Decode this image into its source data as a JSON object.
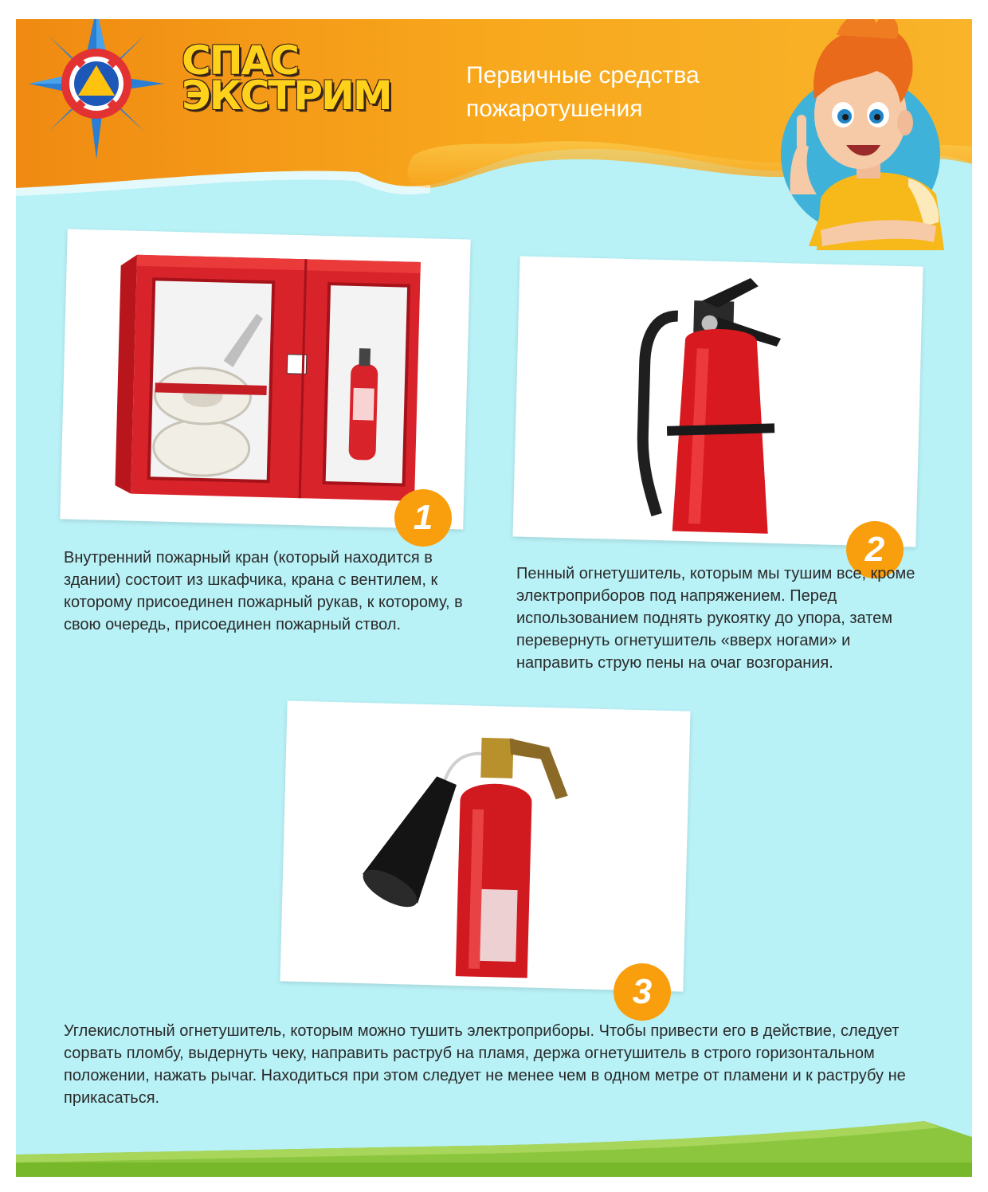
{
  "header": {
    "brand_line1": "СПАС",
    "brand_line2": "ЭКСТРИМ",
    "title": "Первичные средства пожаротушения"
  },
  "items": [
    {
      "number": "1",
      "description": "Внутренний пожарный кран (который находится в здании) состоит из шкафчика, крана с вентилем, к которому присоединен пожарный рукав, к которому, в свою очередь, присоединен пожарный ствол."
    },
    {
      "number": "2",
      "description": "Пенный огнетушитель, которым мы тушим все, кроме электроприборов под напряжением. Перед использованием поднять рукоятку до упора, затем перевернуть огнетушитель «вверх ногами» и направить струю пены на очаг возгорания."
    },
    {
      "number": "3",
      "description": "Углекислотный огнетушитель, которым можно тушить электроприборы.  Чтобы привести его в действие, следует сорвать пломбу, выдернуть чеку, направить раструб на пламя, держа огнетушитель в строго горизонтальном положении, нажать рычаг. Находиться при этом следует не менее чем в одном метре от пламени и к раструбу не прикасаться."
    }
  ],
  "colors": {
    "background": "#b8f1f6",
    "header_orange": "#f7a41c",
    "badge": "#f99f0e",
    "grass": "#76b82a"
  },
  "icons": [
    "emergency-star-logo",
    "boy-mascot",
    "fire-hose-cabinet",
    "foam-extinguisher",
    "co2-extinguisher"
  ]
}
